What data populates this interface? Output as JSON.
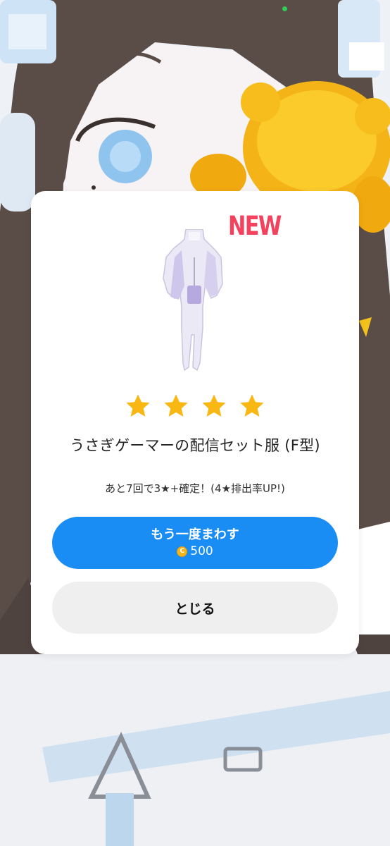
{
  "result": {
    "new_badge": "NEW",
    "star_count": 4,
    "item_name": "うさぎゲーマーの配信セット服 (F型)",
    "gacha_note": "あと7回で3★+確定！(4★排出率UP!)"
  },
  "actions": {
    "spin_again_label": "もう一度まわす",
    "spin_cost": "500",
    "close_label": "とじる"
  },
  "colors": {
    "primary_button": "#1a8df5",
    "star": "#f9b714",
    "new_badge": "#f4415d",
    "coin": "#f3b51c"
  },
  "icons": {
    "star": "star-icon",
    "coin": "coin-icon",
    "status": "status-indicator"
  }
}
